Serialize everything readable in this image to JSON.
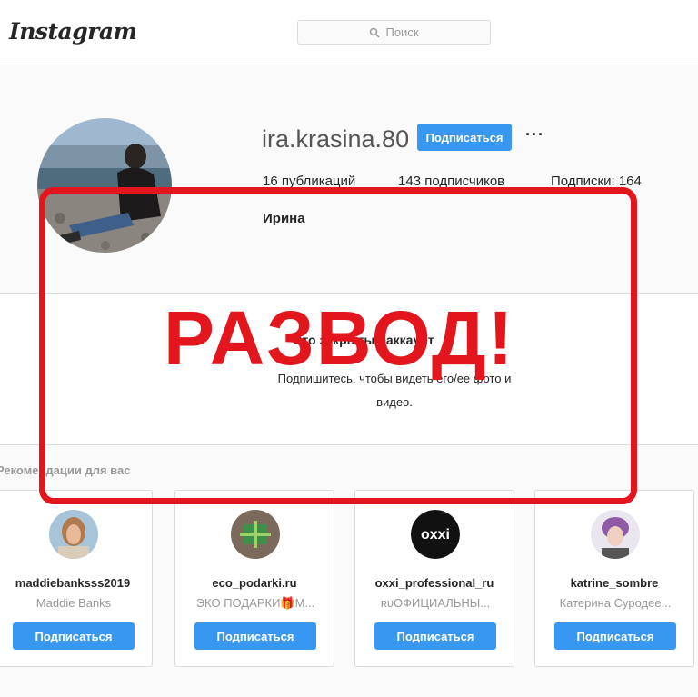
{
  "header": {
    "logo": "Instagram",
    "search_placeholder": "Поиск"
  },
  "profile": {
    "username": "ira.krasina.80",
    "follow_label": "Подписаться",
    "more_label": "···",
    "posts": "16 публикаций",
    "followers": "143 подписчиков",
    "following": "Подписки: 164",
    "full_name": "Ирина"
  },
  "private": {
    "title": "Это закрытый аккаунт",
    "description": "Подпишитесь, чтобы видеть его/ее фото и видео."
  },
  "recommendations": {
    "heading": "Рекомендации для вас",
    "items": [
      {
        "username": "maddiebanksss2019",
        "name": "Maddie Banks",
        "button": "Подписаться"
      },
      {
        "username": "eco_podarki.ru",
        "name": "ЭКО ПОДАРКИ🎁М...",
        "button": "Подписаться"
      },
      {
        "username": "oxxi_professional_ru",
        "name": "ʀᴜОФИЦИАЛЬНЫ...",
        "button": "Подписаться"
      },
      {
        "username": "katrine_sombre",
        "name": "Катерина Суродее...",
        "button": "Подписаться"
      }
    ]
  },
  "overlay": {
    "text": "РАЗВОД!",
    "color": "#e3161e"
  },
  "colors": {
    "accent": "#3897f0"
  }
}
